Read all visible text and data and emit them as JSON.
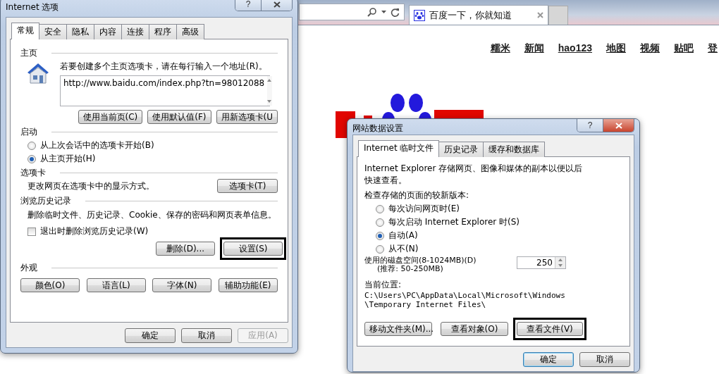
{
  "browser": {
    "tab": {
      "title": "百度一下，你就知道"
    },
    "nav_links": [
      "糯米",
      "新闻",
      "hao123",
      "地图",
      "视频",
      "贴吧",
      "登"
    ]
  },
  "options_dialog": {
    "title": "Internet 选项",
    "help": "?",
    "tabs": [
      {
        "label": "常规",
        "selected": true
      },
      {
        "label": "安全",
        "selected": false
      },
      {
        "label": "隐私",
        "selected": false
      },
      {
        "label": "内容",
        "selected": false
      },
      {
        "label": "连接",
        "selected": false
      },
      {
        "label": "程序",
        "selected": false
      },
      {
        "label": "高级",
        "selected": false
      }
    ],
    "home_page": {
      "heading": "主页",
      "instruction": "若要创建多个主页选项卡，请在每行输入一个地址(R)。",
      "url": "http://www.baidu.com/index.php?tn=98012088",
      "buttons": [
        "使用当前页(C)",
        "使用默认值(F)",
        "用新选项卡(U"
      ]
    },
    "startup": {
      "heading": "启动",
      "options": [
        {
          "label": "从上次会话中的选项卡开始(B)",
          "selected": false
        },
        {
          "label": "从主页开始(H)",
          "selected": true
        }
      ]
    },
    "tabs_section": {
      "heading": "选项卡",
      "description": "更改网页在选项卡中的显示方式。",
      "button": "选项卡(T)"
    },
    "history": {
      "heading": "浏览历史记录",
      "description": "删除临时文件、历史记录、Cookie、保存的密码和网页表单信息。",
      "checkbox": {
        "label": "退出时删除浏览历史记录(W)",
        "checked": false
      },
      "buttons": [
        {
          "label": "删除(D)...",
          "highlighted": false
        },
        {
          "label": "设置(S)",
          "highlighted": true
        }
      ]
    },
    "appearance": {
      "heading": "外观",
      "buttons": [
        "颜色(O)",
        "语言(L)",
        "字体(N)",
        "辅助功能(E)"
      ]
    },
    "footer": [
      {
        "label": "确定",
        "default": false,
        "disabled": false
      },
      {
        "label": "取消",
        "default": false,
        "disabled": false
      },
      {
        "label": "应用(A)",
        "default": false,
        "disabled": true
      }
    ]
  },
  "data_dialog": {
    "title": "网站数据设置",
    "help": "?",
    "tabs": [
      {
        "label": "Internet 临时文件",
        "selected": true
      },
      {
        "label": "历史记录",
        "selected": false
      },
      {
        "label": "缓存和数据库",
        "selected": false
      }
    ],
    "description": "Internet Explorer 存储网页、图像和媒体的副本以便以后快速查看。",
    "check_heading": "检查存储的页面的较新版本:",
    "options": [
      {
        "label": "每次访问网页时(E)",
        "selected": false
      },
      {
        "label": "每次启动 Internet Explorer 时(S)",
        "selected": false
      },
      {
        "label": "自动(A)",
        "selected": true
      },
      {
        "label": "从不(N)",
        "selected": false
      }
    ],
    "disk_label": "使用的磁盘空间(8-1024MB)(D)",
    "recommended": "(推荐: 50-250MB)",
    "disk_value": "250",
    "location_heading": "当前位置:",
    "location_path": "C:\\Users\\PC\\AppData\\Local\\Microsoft\\Windows\\Temporary Internet Files\\",
    "buttons": [
      {
        "label": "移动文件夹(M)...",
        "highlighted": false
      },
      {
        "label": "查看对象(O)",
        "highlighted": false
      },
      {
        "label": "查看文件(V)",
        "highlighted": true
      }
    ],
    "footer": [
      {
        "label": "确定",
        "default": true,
        "disabled": false
      },
      {
        "label": "取消",
        "default": false,
        "disabled": false
      }
    ]
  }
}
